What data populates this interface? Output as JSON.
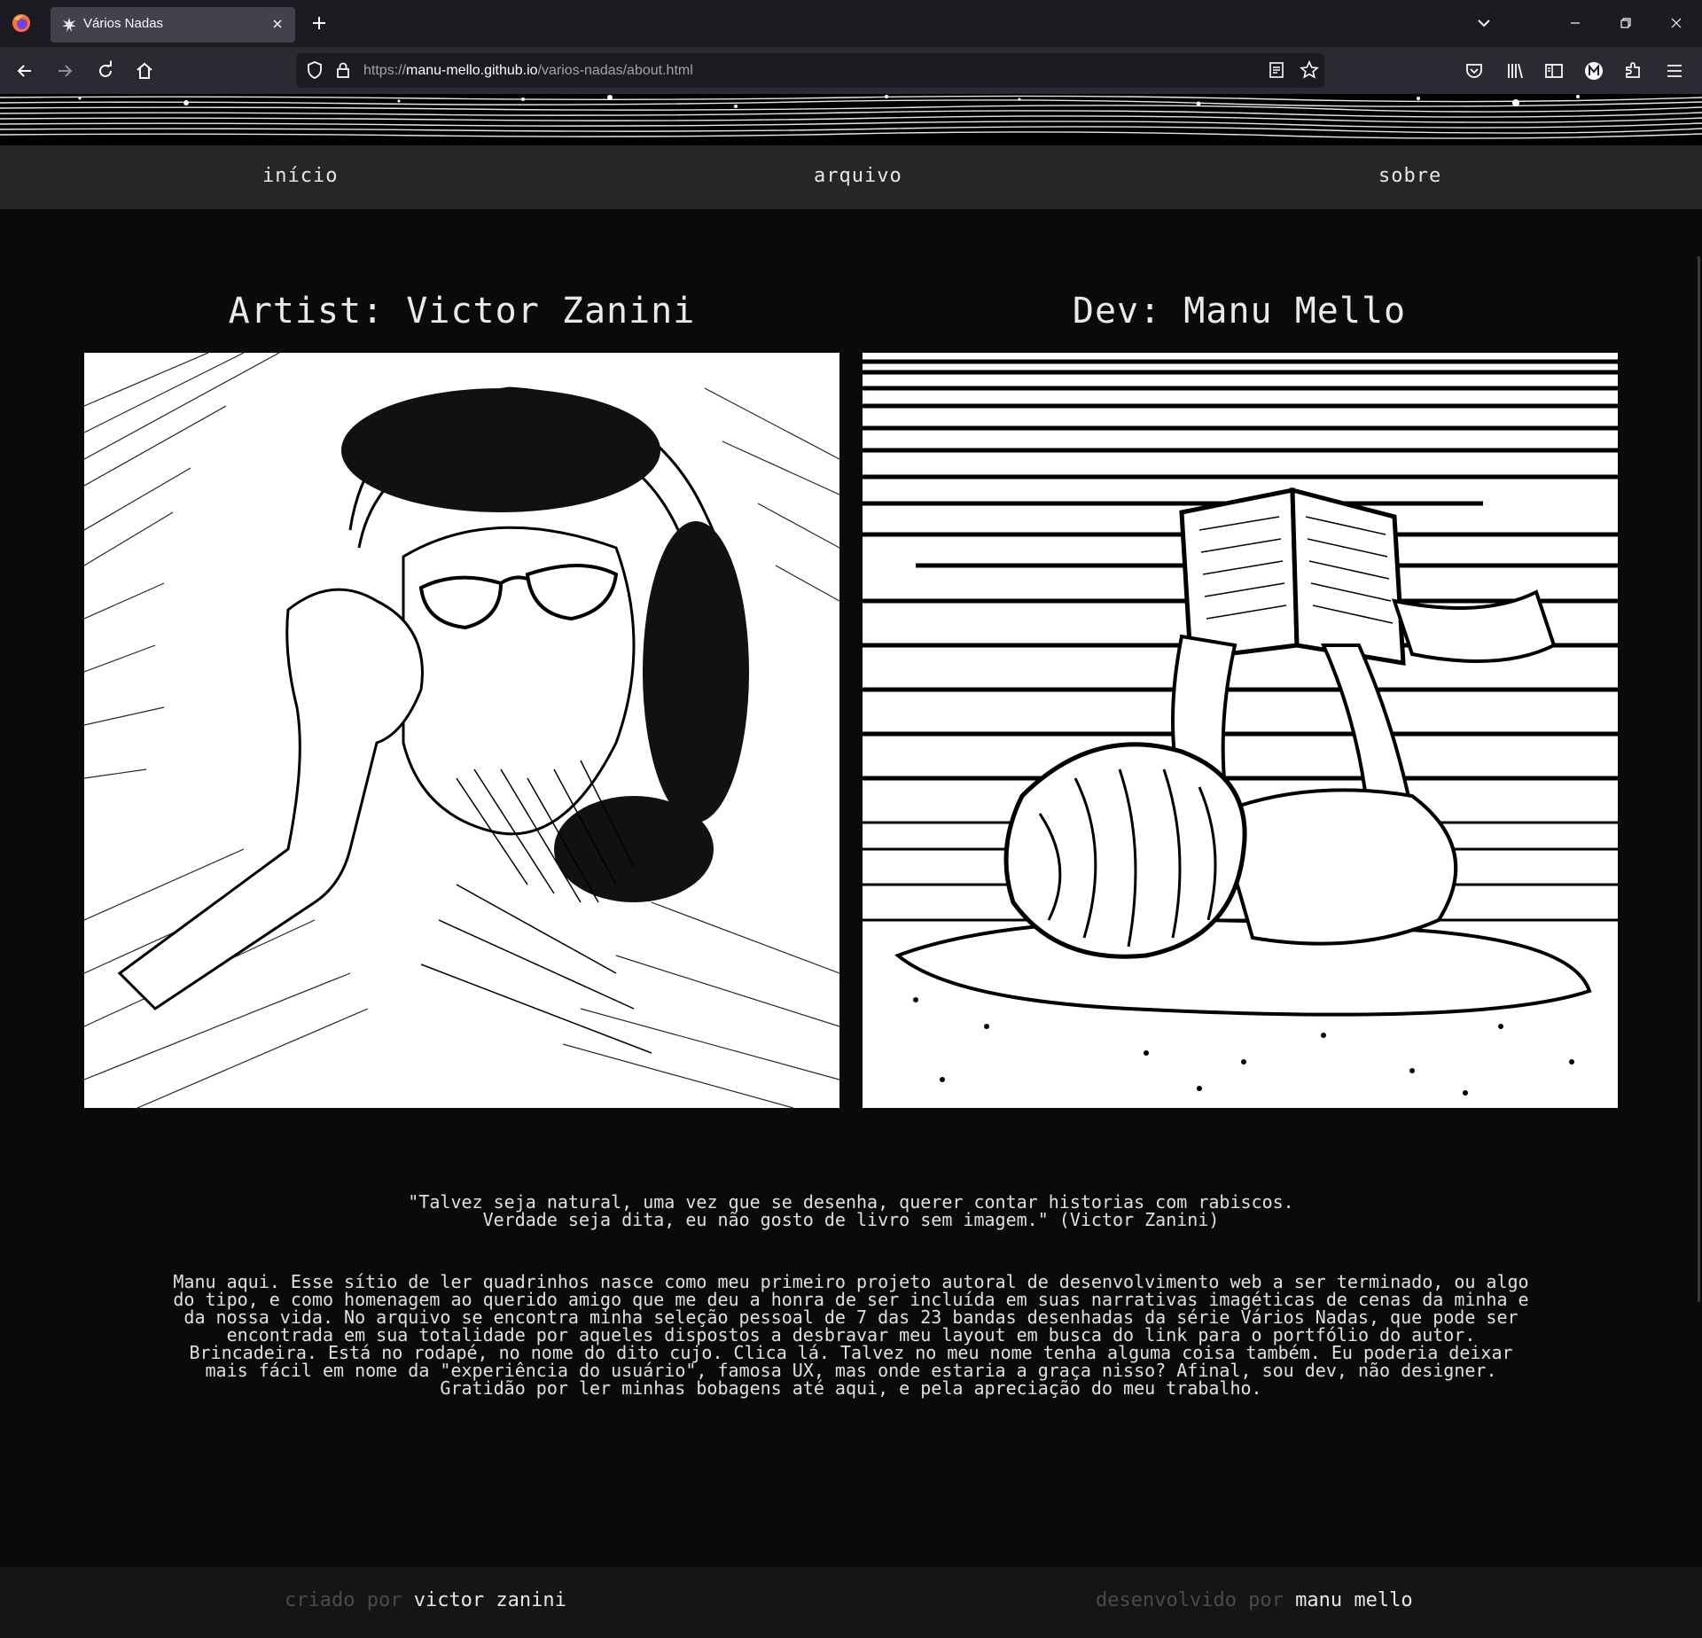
{
  "browser": {
    "tab_title": "Vários Nadas",
    "url_prefix": "https://",
    "url_host": "manu-mello.github.io",
    "url_path": "/varios-nadas/about.html"
  },
  "nav": {
    "items": [
      {
        "label": "início"
      },
      {
        "label": "arquivo"
      },
      {
        "label": "sobre"
      }
    ]
  },
  "artist": {
    "heading": "Artist: Victor Zanini"
  },
  "dev": {
    "heading": "Dev: Manu Mello"
  },
  "quote": "\"Talvez seja natural, uma vez que se desenha, querer contar historias com rabiscos.\nVerdade seja dita, eu não gosto de livro sem imagem.\" (Victor Zanini)",
  "bio": "Manu aqui. Esse sítio de ler quadrinhos nasce como meu primeiro projeto autoral de desenvolvimento web a ser terminado, ou algo\ndo tipo, e como homenagem ao querido amigo que me deu a honra de ser incluída em suas narrativas imagéticas de cenas da minha e\nda nossa vida. No arquivo se encontra minha seleção pessoal de 7 das 23 bandas desenhadas da série Vários Nadas, que pode ser\nencontrada em sua totalidade por aqueles dispostos a desbravar meu layout em busca do link para o portfólio do autor.\nBrincadeira. Está no rodapé, no nome do dito cujo. Clica lá. Talvez no meu nome tenha alguma coisa também. Eu poderia deixar\nmais fácil em nome da \"experiência do usuário\", famosa UX, mas onde estaria a graça nisso? Afinal, sou dev, não designer.\nGratidão por ler minhas bobagens até aqui, e pela apreciação do meu trabalho.",
  "footer": {
    "created_prefix": "criado por",
    "created_name": "victor zanini",
    "dev_prefix": "desenvolvido por",
    "dev_name": "manu mello"
  },
  "colors": {
    "page_bg": "#0a0a0b",
    "menu_bg": "#262626",
    "footer_bg": "#151515",
    "text": "#e6e6e6"
  }
}
